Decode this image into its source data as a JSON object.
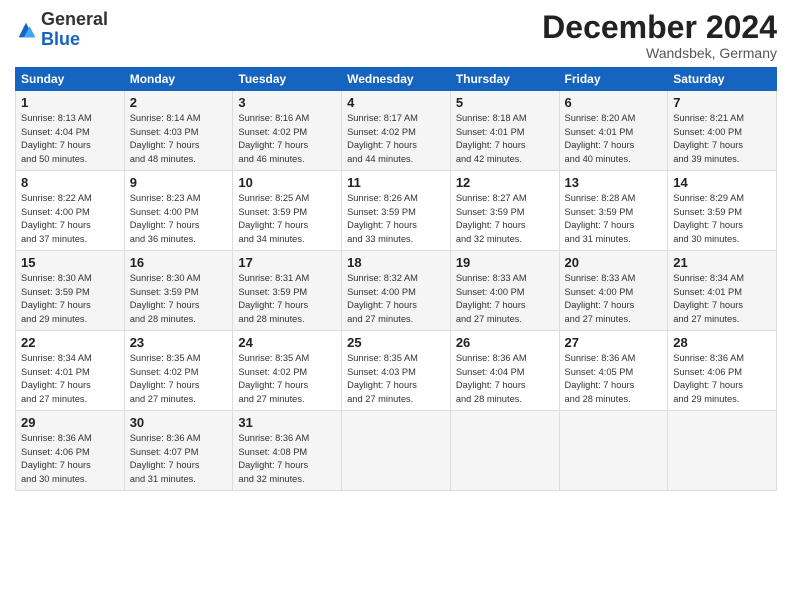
{
  "header": {
    "logo_general": "General",
    "logo_blue": "Blue",
    "title": "December 2024",
    "location": "Wandsbek, Germany"
  },
  "days_of_week": [
    "Sunday",
    "Monday",
    "Tuesday",
    "Wednesday",
    "Thursday",
    "Friday",
    "Saturday"
  ],
  "weeks": [
    [
      {
        "day": "1",
        "sunrise": "8:13 AM",
        "sunset": "4:04 PM",
        "daylight": "7 hours and 50 minutes."
      },
      {
        "day": "2",
        "sunrise": "8:14 AM",
        "sunset": "4:03 PM",
        "daylight": "7 hours and 48 minutes."
      },
      {
        "day": "3",
        "sunrise": "8:16 AM",
        "sunset": "4:02 PM",
        "daylight": "7 hours and 46 minutes."
      },
      {
        "day": "4",
        "sunrise": "8:17 AM",
        "sunset": "4:02 PM",
        "daylight": "7 hours and 44 minutes."
      },
      {
        "day": "5",
        "sunrise": "8:18 AM",
        "sunset": "4:01 PM",
        "daylight": "7 hours and 42 minutes."
      },
      {
        "day": "6",
        "sunrise": "8:20 AM",
        "sunset": "4:01 PM",
        "daylight": "7 hours and 40 minutes."
      },
      {
        "day": "7",
        "sunrise": "8:21 AM",
        "sunset": "4:00 PM",
        "daylight": "7 hours and 39 minutes."
      }
    ],
    [
      {
        "day": "8",
        "sunrise": "8:22 AM",
        "sunset": "4:00 PM",
        "daylight": "7 hours and 37 minutes."
      },
      {
        "day": "9",
        "sunrise": "8:23 AM",
        "sunset": "4:00 PM",
        "daylight": "7 hours and 36 minutes."
      },
      {
        "day": "10",
        "sunrise": "8:25 AM",
        "sunset": "3:59 PM",
        "daylight": "7 hours and 34 minutes."
      },
      {
        "day": "11",
        "sunrise": "8:26 AM",
        "sunset": "3:59 PM",
        "daylight": "7 hours and 33 minutes."
      },
      {
        "day": "12",
        "sunrise": "8:27 AM",
        "sunset": "3:59 PM",
        "daylight": "7 hours and 32 minutes."
      },
      {
        "day": "13",
        "sunrise": "8:28 AM",
        "sunset": "3:59 PM",
        "daylight": "7 hours and 31 minutes."
      },
      {
        "day": "14",
        "sunrise": "8:29 AM",
        "sunset": "3:59 PM",
        "daylight": "7 hours and 30 minutes."
      }
    ],
    [
      {
        "day": "15",
        "sunrise": "8:30 AM",
        "sunset": "3:59 PM",
        "daylight": "7 hours and 29 minutes."
      },
      {
        "day": "16",
        "sunrise": "8:30 AM",
        "sunset": "3:59 PM",
        "daylight": "7 hours and 28 minutes."
      },
      {
        "day": "17",
        "sunrise": "8:31 AM",
        "sunset": "3:59 PM",
        "daylight": "7 hours and 28 minutes."
      },
      {
        "day": "18",
        "sunrise": "8:32 AM",
        "sunset": "4:00 PM",
        "daylight": "7 hours and 27 minutes."
      },
      {
        "day": "19",
        "sunrise": "8:33 AM",
        "sunset": "4:00 PM",
        "daylight": "7 hours and 27 minutes."
      },
      {
        "day": "20",
        "sunrise": "8:33 AM",
        "sunset": "4:00 PM",
        "daylight": "7 hours and 27 minutes."
      },
      {
        "day": "21",
        "sunrise": "8:34 AM",
        "sunset": "4:01 PM",
        "daylight": "7 hours and 27 minutes."
      }
    ],
    [
      {
        "day": "22",
        "sunrise": "8:34 AM",
        "sunset": "4:01 PM",
        "daylight": "7 hours and 27 minutes."
      },
      {
        "day": "23",
        "sunrise": "8:35 AM",
        "sunset": "4:02 PM",
        "daylight": "7 hours and 27 minutes."
      },
      {
        "day": "24",
        "sunrise": "8:35 AM",
        "sunset": "4:02 PM",
        "daylight": "7 hours and 27 minutes."
      },
      {
        "day": "25",
        "sunrise": "8:35 AM",
        "sunset": "4:03 PM",
        "daylight": "7 hours and 27 minutes."
      },
      {
        "day": "26",
        "sunrise": "8:36 AM",
        "sunset": "4:04 PM",
        "daylight": "7 hours and 28 minutes."
      },
      {
        "day": "27",
        "sunrise": "8:36 AM",
        "sunset": "4:05 PM",
        "daylight": "7 hours and 28 minutes."
      },
      {
        "day": "28",
        "sunrise": "8:36 AM",
        "sunset": "4:06 PM",
        "daylight": "7 hours and 29 minutes."
      }
    ],
    [
      {
        "day": "29",
        "sunrise": "8:36 AM",
        "sunset": "4:06 PM",
        "daylight": "7 hours and 30 minutes."
      },
      {
        "day": "30",
        "sunrise": "8:36 AM",
        "sunset": "4:07 PM",
        "daylight": "7 hours and 31 minutes."
      },
      {
        "day": "31",
        "sunrise": "8:36 AM",
        "sunset": "4:08 PM",
        "daylight": "7 hours and 32 minutes."
      },
      null,
      null,
      null,
      null
    ]
  ]
}
